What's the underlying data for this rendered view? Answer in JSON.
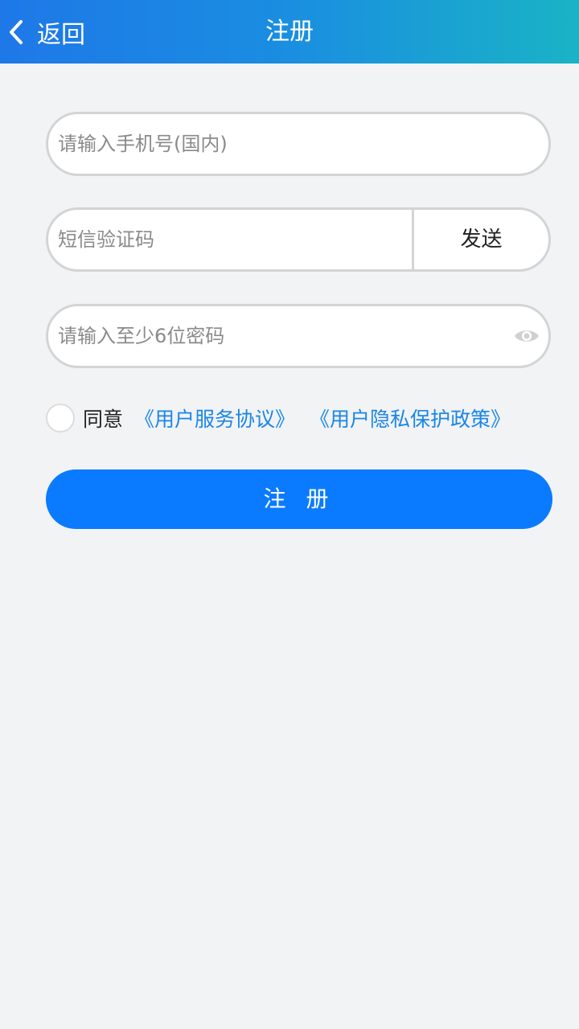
{
  "header": {
    "back_label": "返回",
    "title": "注册",
    "back_icon": "chevron-left-icon"
  },
  "form": {
    "phone": {
      "placeholder": "请输入手机号(国内)",
      "value": ""
    },
    "sms_code": {
      "placeholder": "短信验证码",
      "value": "",
      "send_label": "发送"
    },
    "password": {
      "placeholder": "请输入至少6位密码",
      "value": "",
      "toggle_icon": "eye-icon"
    },
    "agreement": {
      "checked": false,
      "label": "同意",
      "terms_link": "《用户服务协议》",
      "privacy_link": "《用户隐私保护政策》"
    },
    "submit_label": "注 册"
  },
  "colors": {
    "nav_gradient_start": "#1e78e8",
    "nav_gradient_end": "#1ab3c6",
    "primary_button": "#0a7bff",
    "link": "#1a86e8",
    "background": "#f2f3f5",
    "border": "#d3d4d6"
  }
}
